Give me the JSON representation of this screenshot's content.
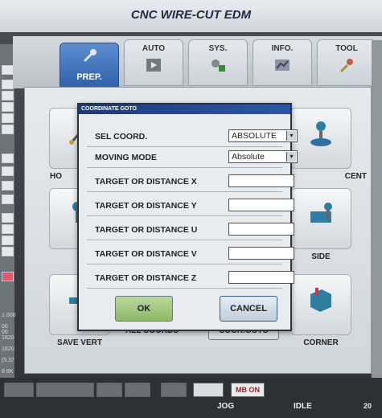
{
  "window": {
    "title": "CNC WIRE-CUT EDM"
  },
  "tabs": [
    {
      "id": "prep",
      "label": "PREP.",
      "icon": "wrench-icon",
      "active": true
    },
    {
      "id": "auto",
      "label": "AUTO",
      "icon": "play-icon"
    },
    {
      "id": "sys",
      "label": "SYS.",
      "icon": "gears-icon"
    },
    {
      "id": "info",
      "label": "INFO.",
      "icon": "chart-icon"
    },
    {
      "id": "tool",
      "label": "TOOL",
      "icon": "tools-icon"
    }
  ],
  "tiles": {
    "ho_label": "HO",
    "cent_label": "CENT",
    "side_label": "SIDE",
    "save_vert_label": "SAVE VERT",
    "all_coords_label": "ALL COORDS",
    "coor_goto_label": "COOR.GOTO",
    "corner_label": "CORNER"
  },
  "dialog": {
    "title": "COORDINATE GOTO",
    "sel_coord_label": "SEL COORD.",
    "sel_coord_value": "ABSOLUTE",
    "moving_mode_label": "MOVING MODE",
    "moving_mode_value": "Absolute",
    "fields": [
      {
        "label": "TARGET OR DISTANCE X",
        "value": ""
      },
      {
        "label": "TARGET OR DISTANCE Y",
        "value": ""
      },
      {
        "label": "TARGET OR DISTANCE U",
        "value": ""
      },
      {
        "label": "TARGET OR DISTANCE V",
        "value": ""
      },
      {
        "label": "TARGET OR DISTANCE Z",
        "value": ""
      }
    ],
    "ok_label": "OK",
    "cancel_label": "CANCEL"
  },
  "left_values": [
    "1.000",
    "00 00",
    "1820",
    "1820",
    "(5.37",
    "8 8K"
  ],
  "bottom": {
    "mb_on": "MB ON",
    "jog": "JOG",
    "idle": "IDLE",
    "corner_text": "20"
  }
}
